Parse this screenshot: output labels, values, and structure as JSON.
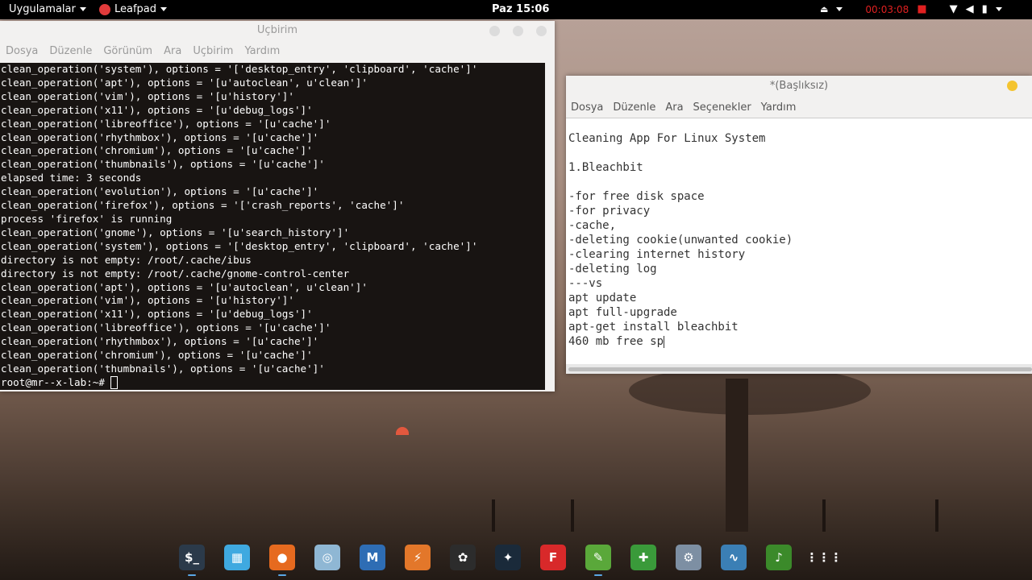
{
  "topbar": {
    "apps_menu": "Uygulamalar",
    "active_app": "Leafpad",
    "clock": "Paz 15:06",
    "rec_timer": "00:03:08"
  },
  "terminal": {
    "title": "Uçbirim",
    "menu": [
      "Dosya",
      "Düzenle",
      "Görünüm",
      "Ara",
      "Uçbirim",
      "Yardım"
    ],
    "lines": [
      "clean_operation('system'), options = '['desktop_entry', 'clipboard', 'cache']'",
      "clean_operation('apt'), options = '[u'autoclean', u'clean']'",
      "clean_operation('vim'), options = '[u'history']'",
      "clean_operation('x11'), options = '[u'debug_logs']'",
      "clean_operation('libreoffice'), options = '[u'cache']'",
      "clean_operation('rhythmbox'), options = '[u'cache']'",
      "clean_operation('chromium'), options = '[u'cache']'",
      "clean_operation('thumbnails'), options = '[u'cache']'",
      "elapsed time: 3 seconds",
      "clean_operation('evolution'), options = '[u'cache']'",
      "clean_operation('firefox'), options = '['crash_reports', 'cache']'",
      "process 'firefox' is running",
      "clean_operation('gnome'), options = '[u'search_history']'",
      "clean_operation('system'), options = '['desktop_entry', 'clipboard', 'cache']'",
      "directory is not empty: /root/.cache/ibus",
      "directory is not empty: /root/.cache/gnome-control-center",
      "clean_operation('apt'), options = '[u'autoclean', u'clean']'",
      "clean_operation('vim'), options = '[u'history']'",
      "clean_operation('x11'), options = '[u'debug_logs']'",
      "clean_operation('libreoffice'), options = '[u'cache']'",
      "clean_operation('rhythmbox'), options = '[u'cache']'",
      "clean_operation('chromium'), options = '[u'cache']'",
      "clean_operation('thumbnails'), options = '[u'cache']'"
    ],
    "prompt": "root@mr--x-lab:~# "
  },
  "leafpad": {
    "title": "*(Başlıksız)",
    "menu": [
      "Dosya",
      "Düzenle",
      "Ara",
      "Seçenekler",
      "Yardım"
    ],
    "lines": [
      "Cleaning App For Linux System",
      "",
      "1.Bleachbit",
      "",
      "-for free disk space",
      "-for privacy",
      "-cache,",
      "-deleting cookie(unwanted cookie)",
      "-clearing internet history",
      "-deleting log",
      "---vs",
      "apt update",
      "apt full-upgrade",
      "apt-get install bleachbit",
      "460 mb free sp"
    ]
  },
  "dock": {
    "apps": [
      {
        "name": "terminal-icon",
        "glyph": "$_",
        "color": "#2b3a4a",
        "running": true
      },
      {
        "name": "files-icon",
        "glyph": "▦",
        "color": "#3fa9e0",
        "running": false
      },
      {
        "name": "firefox-icon",
        "glyph": "●",
        "color": "#e66a1f",
        "running": true
      },
      {
        "name": "settings-disc-icon",
        "glyph": "◎",
        "color": "#8fb7d4",
        "running": false
      },
      {
        "name": "metasploit-icon",
        "glyph": "M",
        "color": "#2e6db4",
        "running": false
      },
      {
        "name": "burp-icon",
        "glyph": "⚡",
        "color": "#e3772a",
        "running": false
      },
      {
        "name": "armitage-icon",
        "glyph": "✿",
        "color": "#2c2c2c",
        "running": false
      },
      {
        "name": "maltego-icon",
        "glyph": "✦",
        "color": "#1a2a3a",
        "running": false
      },
      {
        "name": "faraday-icon",
        "glyph": "F",
        "color": "#d8292a",
        "running": false
      },
      {
        "name": "leafpad-icon",
        "glyph": "✎",
        "color": "#5aa83a",
        "running": true
      },
      {
        "name": "cherrytree-icon",
        "glyph": "✚",
        "color": "#3a9a3a",
        "running": false
      },
      {
        "name": "gear-icon",
        "glyph": "⚙",
        "color": "#7d8fa3",
        "running": false
      },
      {
        "name": "monitor-icon",
        "glyph": "∿",
        "color": "#3b7fb5",
        "running": false
      },
      {
        "name": "music-icon",
        "glyph": "♪",
        "color": "#3b8a2a",
        "running": false
      },
      {
        "name": "app-grid-icon",
        "glyph": "⋮⋮⋮",
        "color": "transparent",
        "running": false
      }
    ]
  }
}
